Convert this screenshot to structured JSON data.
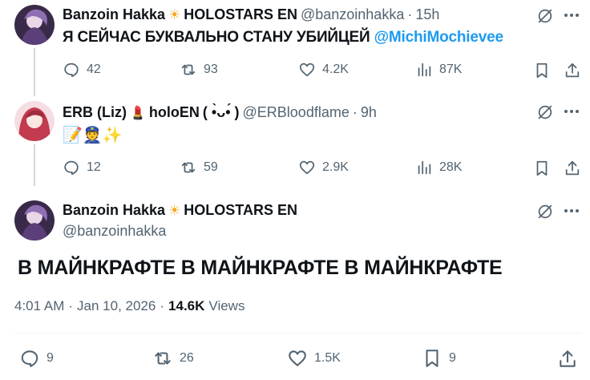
{
  "tweets": [
    {
      "name": "Banzoin Hakka",
      "affiliation": "HOLOSTARS EN",
      "handle": "@banzoinhakka",
      "time": "15h",
      "text": "Я СЕЙЧАС БУКВАЛЬНО СТАНУ УБИЙЦЕЙ",
      "mention": "@MichiMochievee",
      "replies": "42",
      "reposts": "93",
      "likes": "4.2K",
      "views": "87K"
    },
    {
      "name": "ERB (Liz)",
      "affiliation": "holoEN",
      "kaomoji": "( •̀ᴗ•́ )",
      "handle": "@ERBloodflame",
      "time": "9h",
      "emojis": "📝👮✨",
      "replies": "12",
      "reposts": "59",
      "likes": "2.9K",
      "views": "28K"
    }
  ],
  "main_tweet": {
    "name": "Banzoin Hakka",
    "affiliation": "HOLOSTARS EN",
    "handle": "@banzoinhakka",
    "text": "В МАЙНКРАФТЕ В МАЙНКРАФТЕ В МАЙНКРАФТЕ",
    "time": "4:01 AM",
    "date": "Jan 10, 2026",
    "views_count": "14.6K",
    "views_label": "Views",
    "replies": "9",
    "reposts": "26",
    "likes": "1.5K",
    "bookmarks": "9"
  },
  "separator": "·",
  "icons": {
    "reply": "reply-icon",
    "repost": "repost-icon",
    "like": "heart-icon",
    "views": "views-icon",
    "bookmark": "bookmark-icon",
    "share": "share-icon",
    "grok": "grok-icon",
    "more": "more-icon"
  },
  "colors": {
    "text": "#0f1419",
    "muted": "#536471",
    "mention": "#1d9bf0",
    "sun": "#f5a623"
  }
}
